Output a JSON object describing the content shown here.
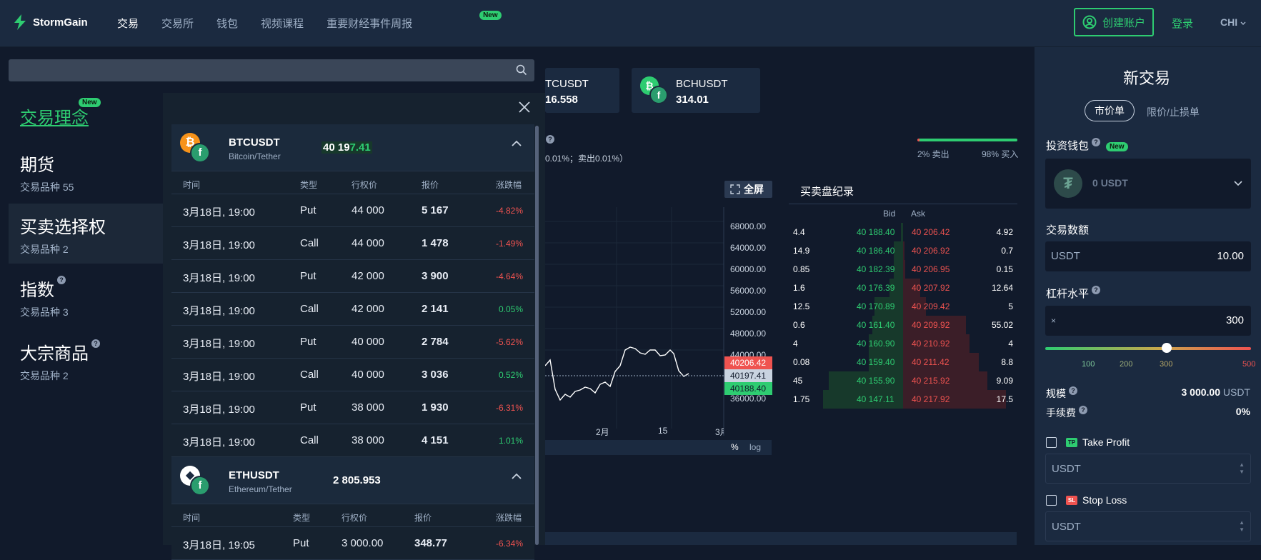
{
  "header": {
    "brand": "StormGain",
    "nav": [
      {
        "label": "交易",
        "active": true
      },
      {
        "label": "交易所",
        "active": false
      },
      {
        "label": "钱包",
        "active": false
      },
      {
        "label": "视频课程",
        "active": false
      },
      {
        "label": "重要财经事件周报",
        "active": false,
        "badge": "New"
      }
    ],
    "create_account": "创建账户",
    "login": "登录",
    "language": "CHI"
  },
  "search": {
    "placeholder": ""
  },
  "left_menu": {
    "items": [
      {
        "title": "交易理念",
        "badge": "New",
        "sub": ""
      },
      {
        "title": "期货",
        "sub": "交易品种 55"
      },
      {
        "title": "买卖选择权",
        "sub": "交易品种 2"
      },
      {
        "title": "指数",
        "sub": "交易品种 3"
      },
      {
        "title": "大宗商品",
        "sub": "交易品种 2"
      }
    ]
  },
  "options": {
    "btc": {
      "symbol": "BTCUSDT",
      "full": "Bitcoin/Tether",
      "price_a": "40 19",
      "price_b": "7.41",
      "headers": [
        "时间",
        "类型",
        "行权价",
        "报价",
        "涨跌幅"
      ],
      "rows": [
        {
          "time": "3月18日, 19:00",
          "type": "Put",
          "strike": "44 000",
          "quote": "5 167",
          "change": "-4.82%",
          "dir": "neg"
        },
        {
          "time": "3月18日, 19:00",
          "type": "Call",
          "strike": "44 000",
          "quote": "1 478",
          "change": "-1.49%",
          "dir": "neg"
        },
        {
          "time": "3月18日, 19:00",
          "type": "Put",
          "strike": "42 000",
          "quote": "3 900",
          "change": "-4.64%",
          "dir": "neg"
        },
        {
          "time": "3月18日, 19:00",
          "type": "Call",
          "strike": "42 000",
          "quote": "2 141",
          "change": "0.05%",
          "dir": "pos"
        },
        {
          "time": "3月18日, 19:00",
          "type": "Put",
          "strike": "40 000",
          "quote": "2 784",
          "change": "-5.62%",
          "dir": "neg"
        },
        {
          "time": "3月18日, 19:00",
          "type": "Call",
          "strike": "40 000",
          "quote": "3 036",
          "change": "0.52%",
          "dir": "pos"
        },
        {
          "time": "3月18日, 19:00",
          "type": "Put",
          "strike": "38 000",
          "quote": "1 930",
          "change": "-6.31%",
          "dir": "neg"
        },
        {
          "time": "3月18日, 19:00",
          "type": "Call",
          "strike": "38 000",
          "quote": "4 151",
          "change": "1.01%",
          "dir": "pos"
        }
      ]
    },
    "eth": {
      "symbol": "ETHUSDT",
      "full": "Ethereum/Tether",
      "price": "2 805.953",
      "headers": [
        "时间",
        "类型",
        "行权价",
        "报价",
        "涨跌幅"
      ],
      "rows": [
        {
          "time": "3月18日, 19:05",
          "type": "Put",
          "strike": "3 000.00",
          "quote": "348.77",
          "change": "-6.34%",
          "dir": "neg"
        }
      ]
    }
  },
  "tiles": [
    {
      "name": "TCUSDT",
      "price": "16.558"
    },
    {
      "name": "BCHUSDT",
      "price": "314.01"
    }
  ],
  "spread_text": "0.01%；卖出0.01%）",
  "sentiment": {
    "sell": "2% 卖出",
    "buy": "98% 买入",
    "buy_fraction": 0.98
  },
  "chart": {
    "fullscreen": "全屏",
    "y_ticks": [
      "68000.00",
      "64000.00",
      "60000.00",
      "56000.00",
      "52000.00",
      "48000.00",
      "44000.00",
      "36000.00"
    ],
    "x_ticks": [
      "2月",
      "15",
      "3月"
    ],
    "ask_tag": "40206.42",
    "last_tag": "40197.41",
    "bid_tag": "40188.40",
    "pct": "%",
    "log": "log"
  },
  "book": {
    "title": "买卖盘纪录",
    "bid_header": "Bid",
    "ask_header": "Ask",
    "rows": [
      {
        "bid_size": "4.4",
        "bid": "40 188.40",
        "ask": "40 206.42",
        "ask_size": "4.92",
        "bid_depth": 0.02,
        "ask_depth": 0.0
      },
      {
        "bid_size": "14.9",
        "bid": "40 186.40",
        "ask": "40 206.92",
        "ask_size": "0.7",
        "bid_depth": 0.08,
        "ask_depth": 0.01
      },
      {
        "bid_size": "0.85",
        "bid": "40 182.39",
        "ask": "40 206.95",
        "ask_size": "0.15",
        "bid_depth": 0.08,
        "ask_depth": 0.02
      },
      {
        "bid_size": "1.6",
        "bid": "40 176.39",
        "ask": "40 207.92",
        "ask_size": "12.64",
        "bid_depth": 0.12,
        "ask_depth": 0.15
      },
      {
        "bid_size": "12.5",
        "bid": "40 170.89",
        "ask": "40 209.42",
        "ask_size": "5",
        "bid_depth": 0.25,
        "ask_depth": 0.2
      },
      {
        "bid_size": "0.6",
        "bid": "40 161.40",
        "ask": "40 209.92",
        "ask_size": "55.02",
        "bid_depth": 0.27,
        "ask_depth": 0.55
      },
      {
        "bid_size": "4",
        "bid": "40 160.90",
        "ask": "40 210.92",
        "ask_size": "4",
        "bid_depth": 0.3,
        "ask_depth": 0.58
      },
      {
        "bid_size": "0.08",
        "bid": "40 159.40",
        "ask": "40 211.42",
        "ask_size": "8.8",
        "bid_depth": 0.3,
        "ask_depth": 0.66
      },
      {
        "bid_size": "45",
        "bid": "40 155.90",
        "ask": "40 215.92",
        "ask_size": "9.09",
        "bid_depth": 0.65,
        "ask_depth": 0.74
      },
      {
        "bid_size": "1.75",
        "bid": "40 147.11",
        "ask": "40 217.92",
        "ask_size": "17.5",
        "bid_depth": 0.7,
        "ask_depth": 0.9
      }
    ]
  },
  "trade": {
    "title": "新交易",
    "tab_market": "市价单",
    "tab_limit": "限价/止损单",
    "wallet_label": "投资钱包",
    "wallet_badge": "New",
    "wallet_value": "0",
    "wallet_unit": "USDT",
    "amount_label": "交易数额",
    "amount_unit": "USDT",
    "amount_value": "10.00",
    "leverage_label": "杠杆水平",
    "leverage_prefix": "×",
    "leverage_value": "300",
    "leverage_ticks": [
      "100",
      "200",
      "300",
      "500"
    ],
    "size_label": "规模",
    "size_value": "3 000.00",
    "size_unit": "USDT",
    "fee_label": "手续费",
    "fee_value": "0%",
    "tp_badge": "TP",
    "tp_label": "Take Profit",
    "tp_placeholder": "USDT",
    "sl_badge": "SL",
    "sl_label": "Stop Loss",
    "sl_placeholder": "USDT"
  },
  "colors": {
    "accent": "#2ecc71",
    "negative": "#ef5350",
    "panel": "#1b2a40",
    "bg": "#111a2b"
  }
}
